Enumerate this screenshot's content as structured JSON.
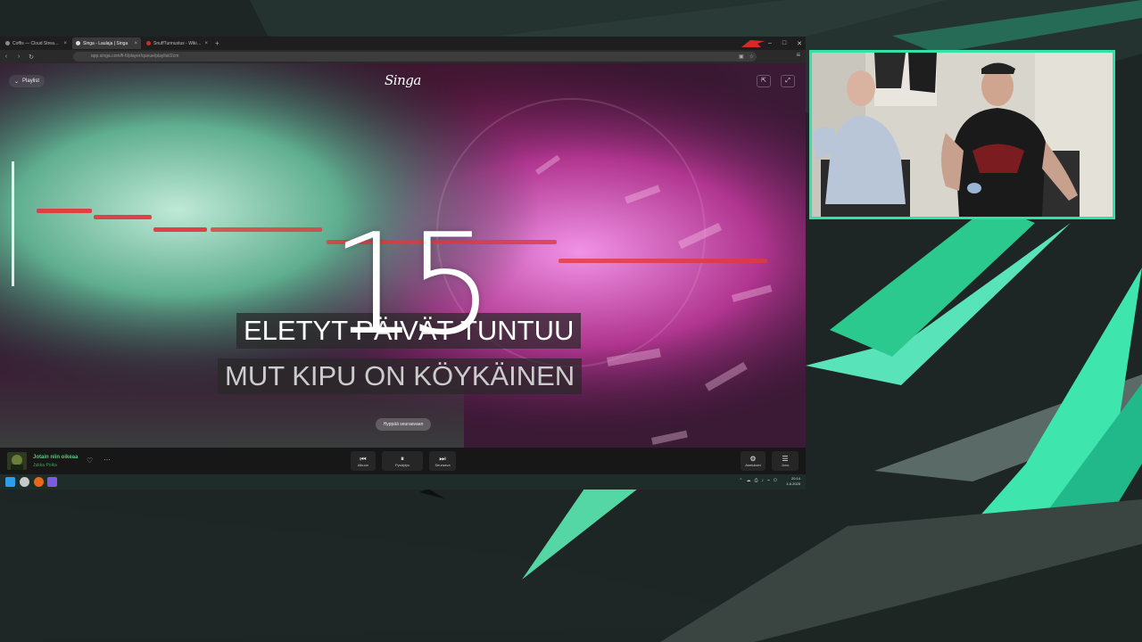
{
  "browser": {
    "tabs": [
      {
        "label": "Coffis — Cloud Streaming Bo",
        "favicon_color": "#8a8a8a",
        "active": false
      },
      {
        "label": "Singa - Laulaja | Singa",
        "favicon_color": "#dcdcdc",
        "active": true
      },
      {
        "label": "SnuffTunnustus - Wiki noun",
        "favicon_color": "#c4302b",
        "active": false
      }
    ],
    "new_tab": "+",
    "window_controls": [
      "–",
      "□",
      "✕"
    ],
    "nav": {
      "back": "‹",
      "forward": "›",
      "reload": "↻"
    },
    "url": "app.singa.com/fi-fi/player/queue/playlist/2cm",
    "toolbar_menu": "≡"
  },
  "player": {
    "logo": "Singa",
    "playlist_button": "Playlist",
    "countdown": "15",
    "lyrics": [
      {
        "text": "ELETYT PÄIVÄT TUNTUU"
      },
      {
        "text": "MUT KIPU ON KÖYKÄINEN"
      }
    ],
    "skip_button": "Hyppää seuraavaan",
    "progress": 0.035,
    "accent_color": "#3ecf72",
    "pitch_color": "#e03a3e"
  },
  "player_bar": {
    "song_title": "Jotain niin oikeaa",
    "song_artist": "Jukka Poika",
    "heart": "♡",
    "more": "···",
    "controls": [
      {
        "name": "restart",
        "glyph": "⏮",
        "label": "Alkuun"
      },
      {
        "name": "pause",
        "glyph": "⏸",
        "label": "Pysäytys"
      },
      {
        "name": "next",
        "glyph": "⏭",
        "label": "Seuraava"
      }
    ],
    "right_controls": [
      {
        "name": "settings",
        "glyph": "⚙",
        "label": "Asetukset"
      },
      {
        "name": "queue",
        "glyph": "☰",
        "label": "Jono"
      }
    ]
  },
  "taskbar": {
    "apps": [
      {
        "name": "windows-start",
        "color": "#2f9ee8"
      },
      {
        "name": "search",
        "color": "#c8c8c8"
      },
      {
        "name": "firefox",
        "color": "#e66a1b"
      },
      {
        "name": "discord",
        "color": "#7b5ce0"
      }
    ],
    "tray_icons": [
      "⌃",
      "☁",
      "⎙",
      "♪",
      "⌁",
      "⏻"
    ],
    "time": "20:14",
    "date": "4.6.2025"
  },
  "overlay": {
    "accent_color": "#2ee3a5",
    "bg_color": "#1b2321"
  }
}
